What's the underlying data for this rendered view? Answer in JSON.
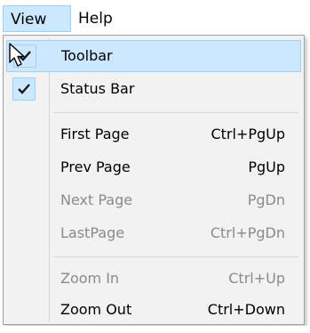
{
  "menubar": {
    "items": [
      {
        "label": "View"
      },
      {
        "label": "Help"
      }
    ]
  },
  "view_menu": {
    "items": [
      {
        "label": "Toolbar",
        "shortcut": "",
        "checked": true,
        "enabled": true,
        "highlighted": true
      },
      {
        "label": "Status Bar",
        "shortcut": "",
        "checked": true,
        "enabled": true,
        "highlighted": false
      },
      {
        "label": "First Page",
        "shortcut": "Ctrl+PgUp",
        "checked": false,
        "enabled": true
      },
      {
        "label": "Prev Page",
        "shortcut": "PgUp",
        "checked": false,
        "enabled": true
      },
      {
        "label": "Next Page",
        "shortcut": "PgDn",
        "checked": false,
        "enabled": false
      },
      {
        "label": "LastPage",
        "shortcut": "Ctrl+PgDn",
        "checked": false,
        "enabled": false
      },
      {
        "label": "Zoom In",
        "shortcut": "Ctrl+Up",
        "checked": false,
        "enabled": false
      },
      {
        "label": "Zoom Out",
        "shortcut": "Ctrl+Down",
        "checked": false,
        "enabled": true
      }
    ]
  },
  "icons": {
    "check": "checkmark-icon",
    "cursor": "mouse-pointer-icon"
  },
  "colors": {
    "highlight_fill": "#cce8ff",
    "highlight_border": "#99d1ff",
    "menu_background": "#f2f2f2",
    "disabled_text": "#8a8a8a"
  }
}
